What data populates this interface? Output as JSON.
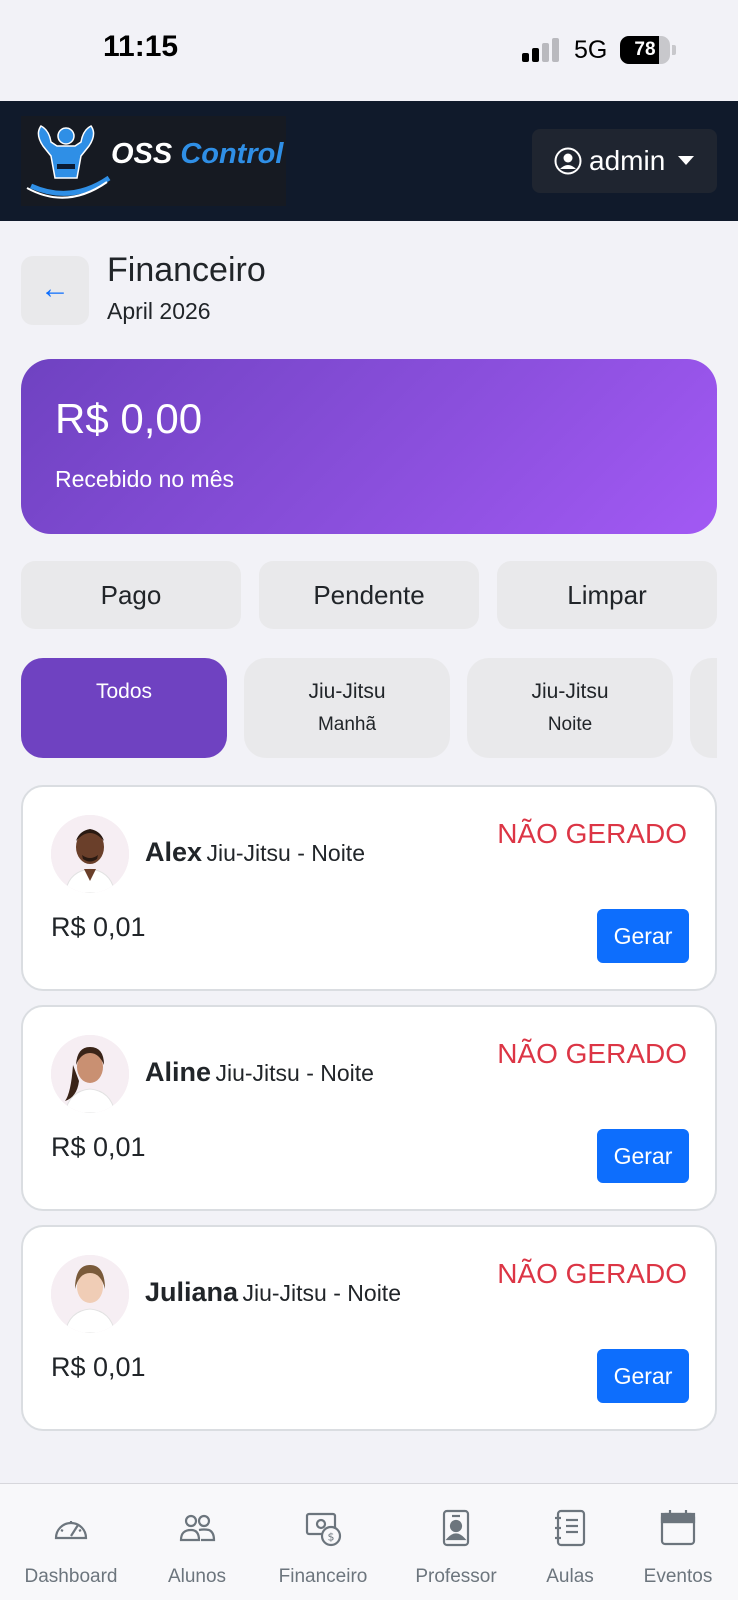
{
  "status_bar": {
    "time": "11:15",
    "network": "5G",
    "battery": "78"
  },
  "navbar": {
    "logo_text_1": "OSS",
    "logo_text_2": "Control",
    "user_label": "admin"
  },
  "header": {
    "title": "Financeiro",
    "subtitle": "April 2026",
    "back_icon": "←"
  },
  "summary": {
    "amount": "R$ 0,00",
    "label": "Recebido no mês",
    "gradient_start": "#6f42c1",
    "gradient_end": "#a259f4"
  },
  "filters": [
    {
      "label": "Pago"
    },
    {
      "label": "Pendente"
    },
    {
      "label": "Limpar"
    }
  ],
  "class_tabs": [
    {
      "line1": "Todos",
      "line2": "",
      "active": true
    },
    {
      "line1": "Jiu-Jitsu",
      "line2": "Manhã",
      "active": false
    },
    {
      "line1": "Jiu-Jitsu",
      "line2": "Noite",
      "active": false
    }
  ],
  "students": [
    {
      "name": "Alex",
      "class": "Jiu-Jitsu - Noite",
      "status": "NÃO GERADO",
      "amount": "R$ 0,01",
      "action": "Gerar"
    },
    {
      "name": "Aline",
      "class": "Jiu-Jitsu - Noite",
      "status": "NÃO GERADO",
      "amount": "R$ 0,01",
      "action": "Gerar"
    },
    {
      "name": "Juliana",
      "class": "Jiu-Jitsu - Noite",
      "status": "NÃO GERADO",
      "amount": "R$ 0,01",
      "action": "Gerar"
    }
  ],
  "bottom_nav": [
    {
      "label": "Dashboard",
      "icon": "speedometer-icon"
    },
    {
      "label": "Alunos",
      "icon": "people-icon"
    },
    {
      "label": "Financeiro",
      "icon": "cash-icon"
    },
    {
      "label": "Professor",
      "icon": "badge-icon"
    },
    {
      "label": "Aulas",
      "icon": "journal-icon"
    },
    {
      "label": "Eventos",
      "icon": "calendar-icon"
    }
  ],
  "colors": {
    "accent": "#6f42c1",
    "primary_button": "#0d6efd",
    "status_danger": "#dc3545",
    "navbar": "#101a2b"
  }
}
